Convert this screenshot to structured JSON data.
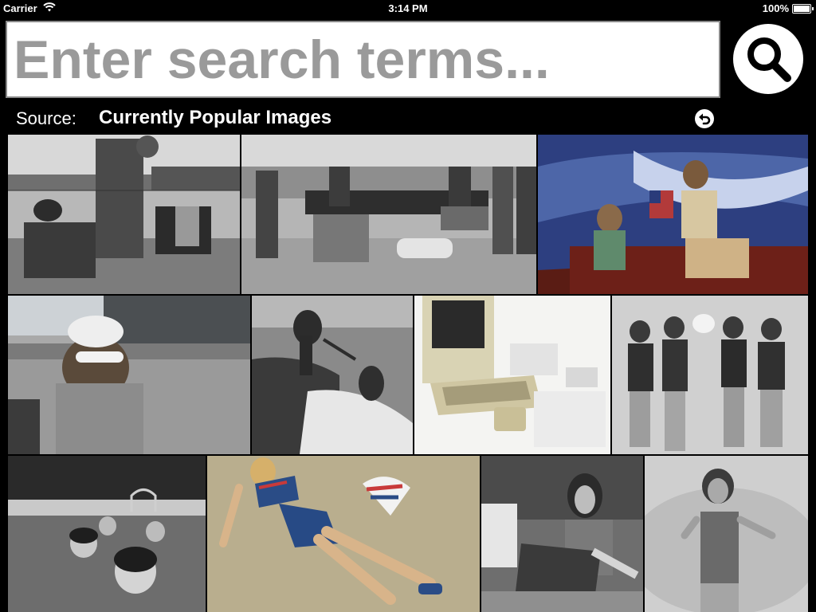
{
  "status_bar": {
    "carrier": "Carrier",
    "time": "3:14 PM",
    "battery": "100%"
  },
  "search": {
    "placeholder": "Enter search terms...",
    "value": ""
  },
  "source": {
    "label": "Source:",
    "value": "Currently Popular Images"
  },
  "icons": {
    "search_button": "magnifier-icon",
    "reset_button": "undo-arrow-icon",
    "wifi": "wifi-icon",
    "battery": "battery-icon"
  },
  "colors": {
    "background": "#000000",
    "search_field": "#ffffff",
    "placeholder": "#9a9a9a"
  }
}
